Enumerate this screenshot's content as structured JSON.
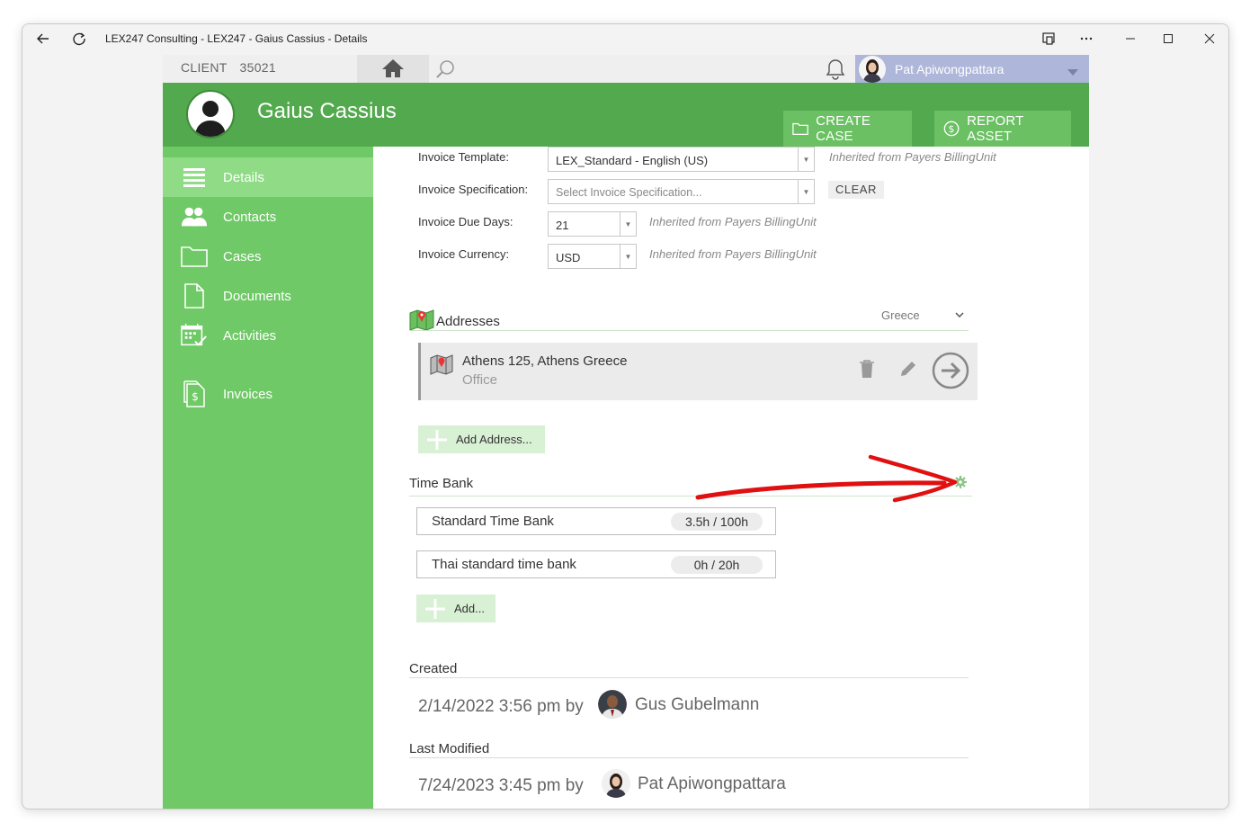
{
  "window": {
    "title": "LEX247 Consulting - LEX247 - Gaius Cassius - Details"
  },
  "topbar": {
    "client_label": "CLIENT",
    "client_id": "35021",
    "user_name": "Pat Apiwongpattara"
  },
  "header": {
    "client_name": "Gaius Cassius",
    "create_case_label": "CREATE CASE",
    "report_asset_label": "REPORT ASSET"
  },
  "sidebar": {
    "items": [
      {
        "label": "Details",
        "icon": "list-icon",
        "active": true
      },
      {
        "label": "Contacts",
        "icon": "people-icon"
      },
      {
        "label": "Cases",
        "icon": "folder-icon"
      },
      {
        "label": "Documents",
        "icon": "document-icon"
      },
      {
        "label": "Activities",
        "icon": "calendar-check-icon"
      },
      {
        "label": "Invoices",
        "icon": "invoice-icon"
      }
    ]
  },
  "invoice": {
    "template_label": "Invoice Template:",
    "template_value": "LEX_Standard - English (US)",
    "template_hint": "Inherited from Payers BillingUnit",
    "spec_label": "Invoice Specification:",
    "spec_placeholder": "Select Invoice Specification...",
    "clear_label": "CLEAR",
    "due_label": "Invoice Due Days:",
    "due_value": "21",
    "due_hint": "Inherited from Payers BillingUnit",
    "currency_label": "Invoice Currency:",
    "currency_value": "USD",
    "currency_hint": "Inherited from Payers BillingUnit"
  },
  "addresses": {
    "title": "Addresses",
    "filter_value": "Greece",
    "items": [
      {
        "line": "Athens 125, Athens Greece",
        "type": "Office"
      }
    ],
    "add_label": "Add Address..."
  },
  "time_bank": {
    "title": "Time Bank",
    "items": [
      {
        "name": "Standard Time Bank",
        "usage": "3.5h / 100h"
      },
      {
        "name": "Thai standard time bank",
        "usage": "0h / 20h"
      }
    ],
    "add_label": "Add..."
  },
  "created": {
    "title": "Created",
    "date": "2/14/2022 3:56 pm by",
    "user": "Gus Gubelmann"
  },
  "modified": {
    "title": "Last Modified",
    "date": "7/24/2023 3:45 pm by",
    "user": "Pat Apiwongpattara"
  },
  "colors": {
    "header_green": "#53a94d",
    "sidebar_green": "#6fc966",
    "active_green": "#8fdb86",
    "annotation_red": "#e01010"
  }
}
